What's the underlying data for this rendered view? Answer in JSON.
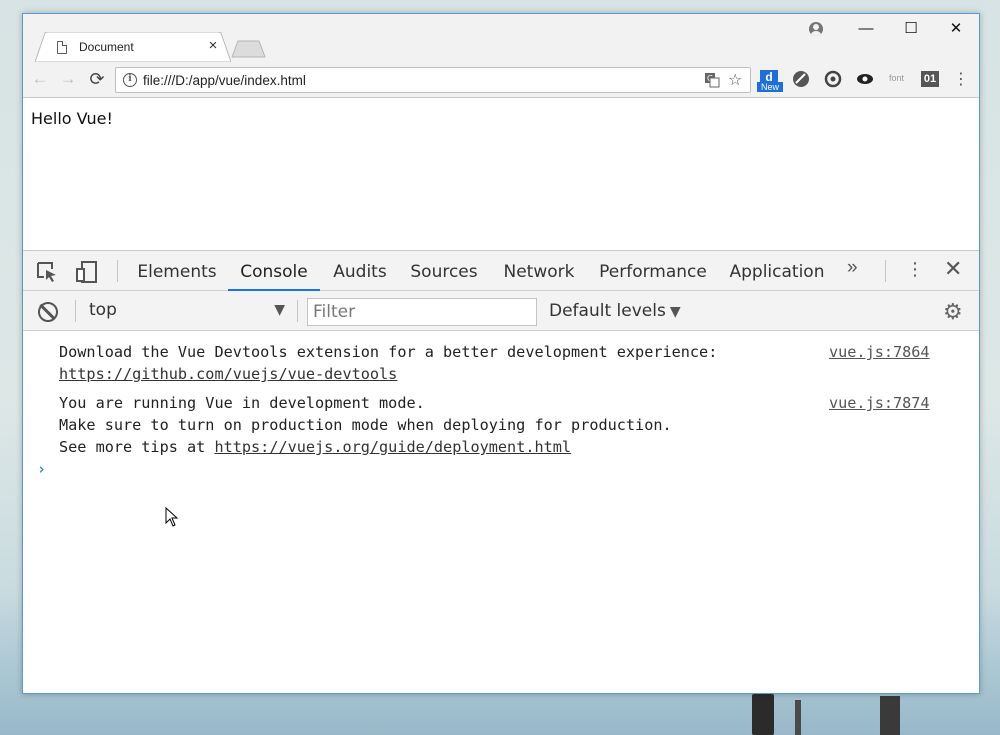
{
  "browser": {
    "tab_title": "Document",
    "tab_close": "×",
    "url": "file:///D:/app/vue/index.html",
    "window_minimize": "—",
    "window_maximize": "☐",
    "window_close": "✕",
    "extensions": {
      "new_badge_letter": "d",
      "new_badge_label": "New",
      "font_label": "font",
      "zero_one_label": "01"
    }
  },
  "page": {
    "text": "Hello Vue!"
  },
  "devtools": {
    "tabs": [
      {
        "label": "Elements",
        "active": false
      },
      {
        "label": "Console",
        "active": true
      },
      {
        "label": "Audits",
        "active": false
      },
      {
        "label": "Sources",
        "active": false
      },
      {
        "label": "Network",
        "active": false
      },
      {
        "label": "Performance",
        "active": false
      },
      {
        "label": "Application",
        "active": false
      }
    ],
    "more_tabs": "»",
    "menu": "⋮",
    "close": "✕",
    "console_bar": {
      "context": "top",
      "filter_placeholder": "Filter",
      "levels": "Default levels"
    },
    "messages": [
      {
        "line1": "Download the Vue Devtools extension for a better development experience:",
        "link": "https://github.com/vuejs/vue-devtools",
        "source": "vue.js:7864"
      },
      {
        "line1": "You are running Vue in development mode.",
        "line2": "Make sure to turn on production mode when deploying for production.",
        "line3_prefix": "See more tips at ",
        "link": "https://vuejs.org/guide/deployment.html",
        "source": "vue.js:7874"
      }
    ],
    "prompt": "›"
  },
  "colors": {
    "accent": "#1a73e8",
    "window_border": "#5b9bd5",
    "prompt": "#2f7fe0"
  }
}
